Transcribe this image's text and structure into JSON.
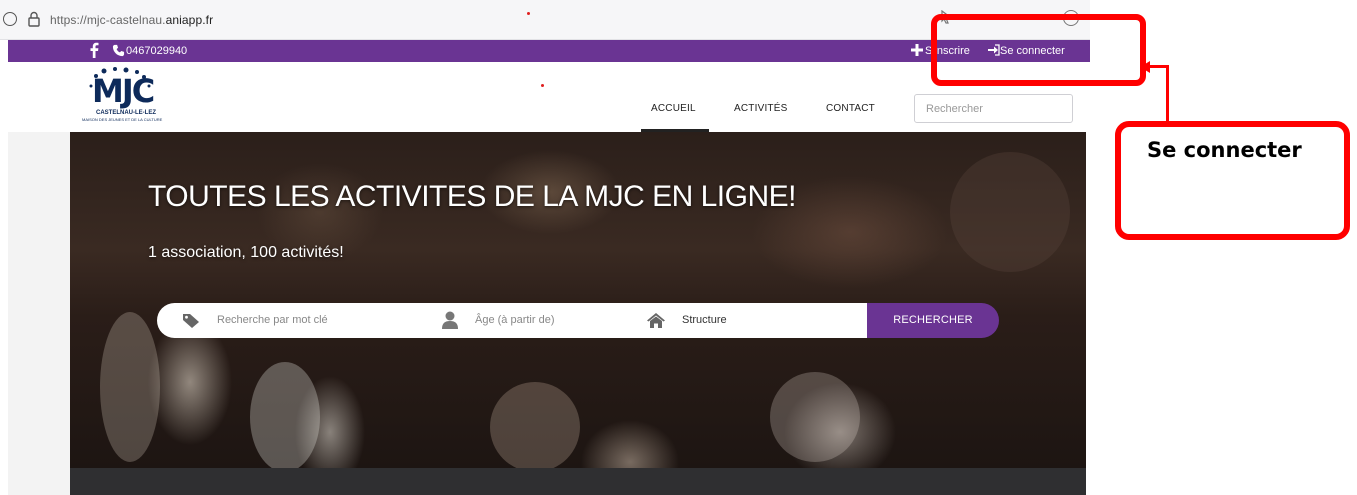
{
  "browser": {
    "url_prefix": "https://mjc-castelnau.",
    "url_domain": "aniapp.fr"
  },
  "topbar": {
    "phone": "0467029940",
    "register_label": "S'inscrire",
    "login_label": "Se connecter",
    "bg_color": "#6a3493"
  },
  "logo": {
    "text": "MJC",
    "town": "CASTELNAU-LE-LEZ",
    "tagline": "MAISON DES JEUNES ET DE LA CULTURE"
  },
  "nav": {
    "items": [
      "ACCUEIL",
      "ACTIVITÉS",
      "CONTACT"
    ],
    "active": "ACCUEIL",
    "search_placeholder": "Rechercher"
  },
  "hero": {
    "title": "TOUTES LES ACTIVITES DE LA MJC EN LIGNE!",
    "subtitle": "1 association, 100 activités!",
    "keyword_placeholder": "Recherche par mot clé",
    "age_placeholder": "Âge (à partir de)",
    "structure_label": "Structure",
    "search_button": "RECHERCHER"
  },
  "annotation": {
    "callout_text": "Se connecter",
    "color": "#ff0000"
  }
}
